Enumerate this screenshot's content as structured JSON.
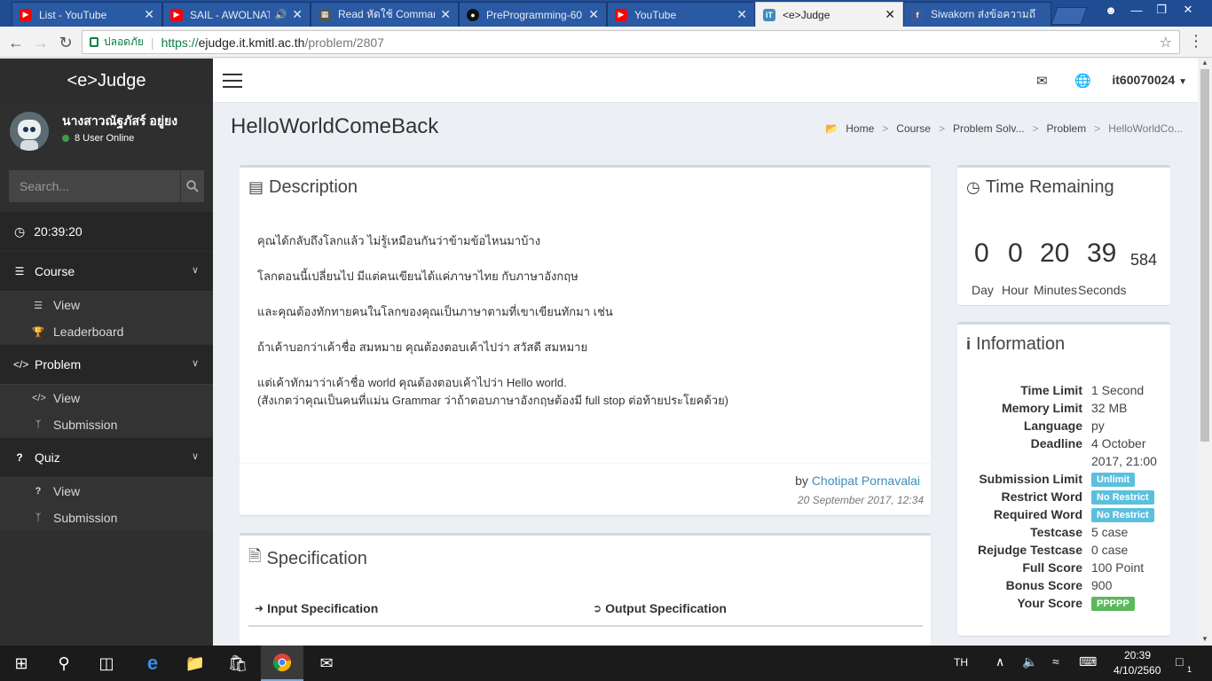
{
  "browser": {
    "tabs": [
      {
        "label": "List - YouTube",
        "favicon": "youtube-icon",
        "color": "#ff0000"
      },
      {
        "label": "SAIL - AWOLNAT",
        "favicon": "youtube-icon",
        "color": "#ff0000"
      },
      {
        "label": "Read หัดใช้ Comman",
        "favicon": "book-icon",
        "color": "#555555"
      },
      {
        "label": "PreProgramming-60",
        "favicon": "github-icon",
        "color": "#111111"
      },
      {
        "label": "YouTube",
        "favicon": "youtube-icon",
        "color": "#ff0000"
      },
      {
        "label": "<e>Judge",
        "favicon": "ejudge-icon",
        "color": "#3c8dbc"
      },
      {
        "label": "Siwakorn ส่งข้อความถึ",
        "favicon": "facebook-icon",
        "color": "#3b5998"
      }
    ],
    "secure_label": "ปลอดภัย",
    "url_scheme": "https://",
    "url_host": "ejudge.it.kmitl.ac.th",
    "url_path": "/problem/2807"
  },
  "sidebar": {
    "brand": "<e>Judge",
    "user_name": "นางสาวณัฐภัสร์ อยู่ยง",
    "online": "8 User Online",
    "search_placeholder": "Search...",
    "clock": "20:39:20",
    "groups": [
      {
        "label": "Course",
        "items": [
          {
            "label": "View"
          },
          {
            "label": "Leaderboard"
          }
        ]
      },
      {
        "label": "Problem",
        "items": [
          {
            "label": "View"
          },
          {
            "label": "Submission"
          }
        ]
      },
      {
        "label": "Quiz",
        "items": [
          {
            "label": "View"
          },
          {
            "label": "Submission"
          }
        ]
      }
    ]
  },
  "header": {
    "username": "it60070024"
  },
  "content": {
    "title": "HelloWorldComeBack",
    "breadcrumb": [
      "Home",
      "Course",
      "Problem Solv...",
      "Problem",
      "HelloWorldCo..."
    ],
    "description": {
      "heading": "Description",
      "paragraphs": [
        "คุณได้กลับถึงโลกแล้ว ไม่รู้เหมือนกันว่าข้ามข้อไหนมาบ้าง",
        "โลกตอนนี้เปลี่ยนไป มีแต่คนเขียนได้แค่ภาษาไทย กับภาษาอังกฤษ",
        "และคุณต้องทักทายคนในโลกของคุณเป็นภาษาตามที่เขาเขียนทักมา เช่น",
        "ถ้าเค้าบอกว่าเค้าชื่อ สมหมาย คุณต้องตอบเค้าไปว่า สวัสดี สมหมาย"
      ],
      "last_line1": "แต่เค้าทักมาว่าเค้าชื่อ world คุณต้องตอบเค้าไปว่า Hello world.",
      "last_line2": "(สังเกตว่าคุณเป็นคนที่แม่น Grammar ว่าถ้าตอบภาษาอังกฤษต้องมี full stop ต่อท้ายประโยคด้วย)",
      "by_prefix": "by",
      "author": "Chotipat Pornavalai",
      "date": "20 September 2017, 12:34"
    },
    "specification": {
      "heading": "Specification",
      "input": "Input Specification",
      "output": "Output Specification"
    },
    "time_remaining": {
      "heading": "Time Remaining",
      "day": "0",
      "hour": "0",
      "minutes": "20",
      "seconds": "39",
      "ms": "584",
      "labels": [
        "Day",
        "Hour",
        "Minutes",
        "Seconds"
      ]
    },
    "information": {
      "heading": "Information",
      "time_limit": "1 Second",
      "memory_limit": "32 MB",
      "language": "py",
      "deadline_line1": "4 October",
      "deadline_line2": "2017, 21:00",
      "submission_limit": "Unlimit",
      "restrict_word": "No Restrict",
      "required_word": "No Restrict",
      "testcase": "5 case",
      "rejudge_testcase": "0 case",
      "full_score": "100 Point",
      "bonus_score": "900",
      "your_score": "PPPPP",
      "keys": {
        "time_limit": "Time Limit",
        "memory_limit": "Memory Limit",
        "language": "Language",
        "deadline": "Deadline",
        "submission_limit": "Submission Limit",
        "restrict_word": "Restrict Word",
        "required_word": "Required Word",
        "testcase": "Testcase",
        "rejudge_testcase": "Rejudge Testcase",
        "full_score": "Full Score",
        "bonus_score": "Bonus Score",
        "your_score": "Your Score"
      }
    }
  },
  "taskbar": {
    "lang": "TH",
    "time": "20:39",
    "date": "4/10/2560",
    "notification_count": "1"
  }
}
